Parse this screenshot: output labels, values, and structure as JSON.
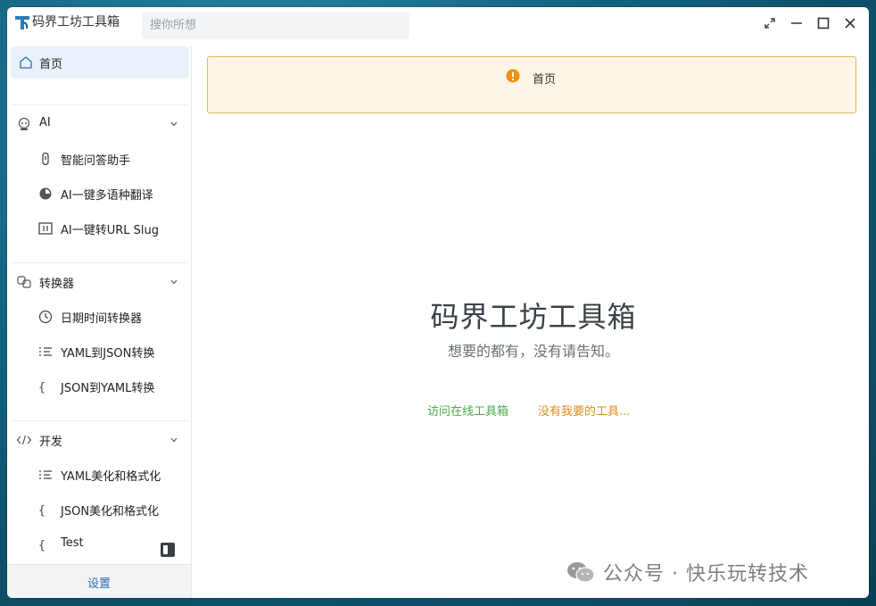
{
  "window": {
    "title": "码界工坊工具箱",
    "search_placeholder": "搜你所想"
  },
  "sidebar": {
    "home_label": "首页",
    "groups": [
      {
        "label": "AI",
        "items": [
          "智能问答助手",
          "AI一键多语种翻译",
          "AI一键转URL Slug"
        ]
      },
      {
        "label": "转换器",
        "items": [
          "日期时间转换器",
          "YAML到JSON转换",
          "JSON到YAML转换"
        ]
      },
      {
        "label": "开发",
        "items": [
          "YAML美化和格式化",
          "JSON美化和格式化",
          "Test"
        ]
      }
    ],
    "settings_label": "设置"
  },
  "content": {
    "alert_text": "首页",
    "title": "码界工坊工具箱",
    "subtitle": "想要的都有，没有请告知。",
    "link_online": "访问在线工具箱",
    "link_request": "没有我要的工具..."
  },
  "watermark": {
    "text": "公众号 · 快乐玩转技术"
  },
  "colors": {
    "accent": "#2a6fb0",
    "home_bg": "#e9f2fb",
    "alert_bg": "#fdf5e6",
    "alert_border": "#e8b45a",
    "alert_icon": "#f0900e",
    "link_green": "#4aa84e",
    "link_orange": "#e08b1a"
  }
}
